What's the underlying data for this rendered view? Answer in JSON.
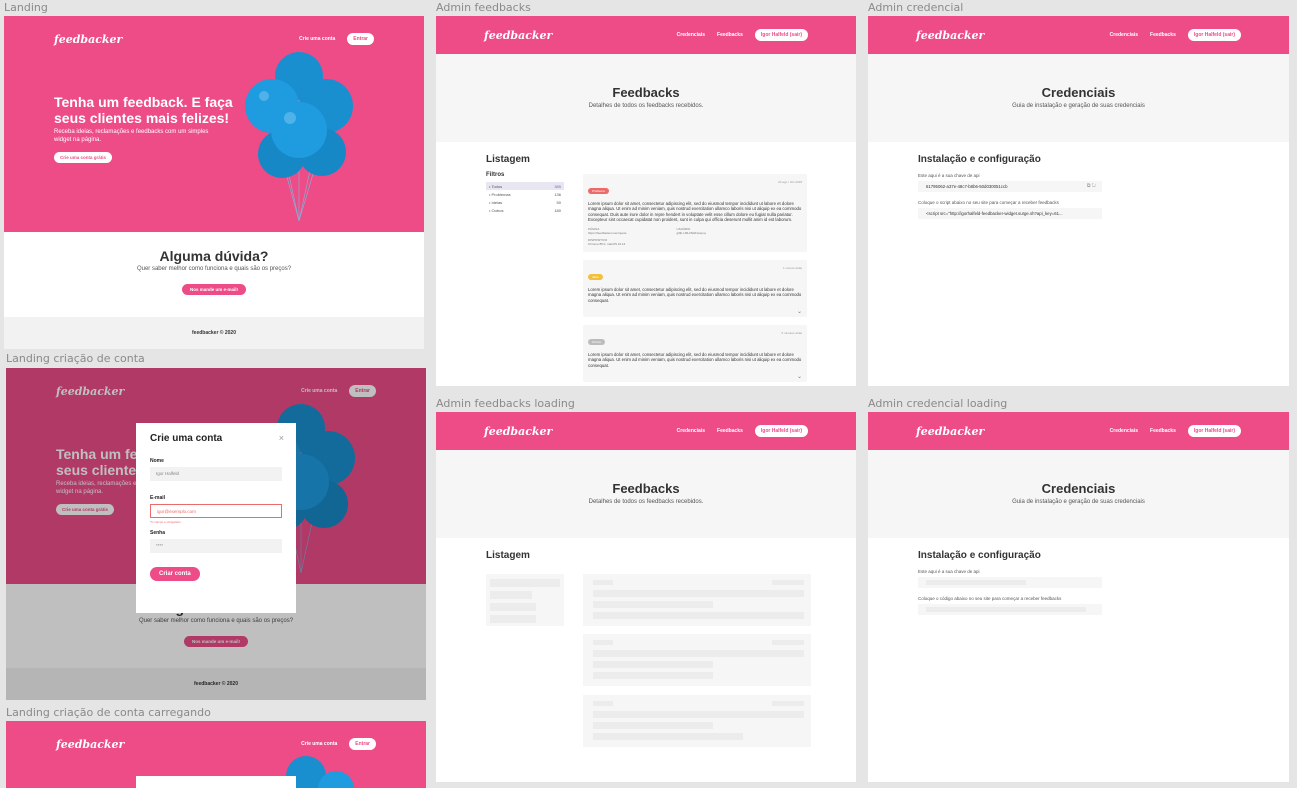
{
  "frames": {
    "landing": "Landing",
    "admin_feedbacks": "Admin feedbacks",
    "admin_credencial": "Admin credencial",
    "landing_criacao": "Landing criação de conta",
    "admin_feedbacks_loading": "Admin feedbacks loading",
    "admin_credencial_loading": "Admin credencial loading",
    "landing_criacao_carregando": "Landing criação de conta carregando"
  },
  "brand": {
    "logo": "feedbacker",
    "color": "#ed4c87"
  },
  "landing": {
    "nav_create": "Crie uma conta",
    "nav_enter": "Entrar",
    "hero_title": "Tenha um feedback. E faça seus clientes mais felizes!",
    "hero_sub": "Receba ideias, reclamações e feedbacks com um simples widget na página.",
    "hero_btn": "Crie uma conta grátis",
    "q_title": "Alguma dúvida?",
    "q_sub": "Quer saber melhor como funciona e quais são os preços?",
    "q_btn": "Nos mande um e-mail!",
    "footer": "feedbacker © 2020"
  },
  "admin": {
    "nav_cred": "Credenciais",
    "nav_feed": "Feedbacks",
    "nav_user": "Igor Halfeld (sair)"
  },
  "feedbacks": {
    "title": "Feedbacks",
    "subtitle": "Detalhes de todos os feedbacks recebidos.",
    "section": "Listagem",
    "filters_title": "Filtros",
    "filters": [
      {
        "label": "• Todos",
        "count": "385"
      },
      {
        "label": "• Problemas",
        "count": "136"
      },
      {
        "label": "• Ideias",
        "count": "50"
      },
      {
        "label": "• Outros",
        "count": "180"
      }
    ],
    "cards": [
      {
        "badge": "Problema",
        "badge_color": "#ed6a6a",
        "time": "20 ago / Oct 2018",
        "text": "Lorem ipsum dolor sit amet, consectetur adipiscing elit, sed do eiusmod tempor incididunt ut labore et dolore magna aliqua. Ut enim ad minim veniam, quis nostrud exercitation ullamco laboris nisi ut aliquip ex ea commodo consequat. Duis aute irure dolor in repre hendert in voluptate velit esse cillum dolore eu fugiat nulla pariatur. Excepteur sint occaecat cupidatat non proident, sunt in culpa qui officia deserunt mollit anim id est laborum.",
        "m1_label": "PÁGINA",
        "m1_value": "https://feedbacker.com/quote",
        "m2_label": "USUÁRIO",
        "m2_value": "g9jh-LML0NHFwxqoq",
        "m3_label": "DISPOSITIVO",
        "m3_value": "Chrome 85.0, macOS 10.14"
      },
      {
        "badge": "Ideia",
        "badge_color": "#f2c139",
        "time": "1 minuto atrás",
        "text": "Lorem ipsum dolor sit amet, consectetur adipiscing elit, sed do eiusmod tempor incididunt ut labore et dolore magna aliqua. Ut enim ad minim veniam, quis nostrud exercitation ullamco laboris nisi ut aliquip ex ea commodo consequat."
      },
      {
        "badge": "Outros",
        "badge_color": "#bcbcbc",
        "time": "5 minutos atrás",
        "text": "Lorem ipsum dolor sit amet, consectetur adipiscing elit, sed do eiusmod tempor incididunt ut labore et dolore magna aliqua. Ut enim ad minim veniam, quis nostrud exercitation ullamco laboris nisi ut aliquip ex ea commodo consequat."
      }
    ]
  },
  "credencial": {
    "title": "Credenciais",
    "subtitle": "Guia de instalação e geração de suas credenciais",
    "section": "Instalação e configuração",
    "api_label": "Este aqui é a sua chave de api",
    "api_key": "61795062-a37e-48c7-b8b6-50d030051ccb",
    "script_label": "Coloque o script abaixo no seu site para começar a receber feedbacks",
    "script_value": "<script src=\"http://igorhalfeld-feedbacker-widget.surge.sh?api_key=61...",
    "script_label_loading": "Coloque o código abaixo no seu site para começar a receber feedbacks"
  },
  "modal": {
    "title": "Crie uma conta",
    "name_label": "Nome",
    "name_value": "Igor Halfeld",
    "email_label": "E-mail",
    "email_value": "igor@exemplo.com",
    "email_error": "*O campo é obrigatório",
    "pass_label": "Senha",
    "pass_value": "****",
    "btn": "Criar conta"
  }
}
